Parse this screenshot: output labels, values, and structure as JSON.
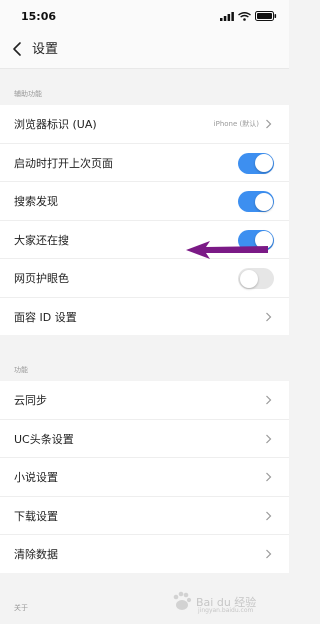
{
  "status_bar": {
    "time": "15:06"
  },
  "header": {
    "title": "设置"
  },
  "sections": [
    {
      "label": "辅助功能",
      "rows": [
        {
          "label": "浏览器标识 (UA)",
          "value": "iPhone (默认)",
          "control": "chevron"
        },
        {
          "label": "启动时打开上次页面",
          "control": "toggle",
          "on": true
        },
        {
          "label": "搜索发现",
          "control": "toggle",
          "on": true
        },
        {
          "label": "大家还在搜",
          "control": "toggle",
          "on": true
        },
        {
          "label": "网页护眼色",
          "control": "toggle",
          "on": false
        },
        {
          "label": "面容 ID 设置",
          "control": "chevron"
        }
      ]
    },
    {
      "label": "功能",
      "rows": [
        {
          "label": "云同步",
          "control": "chevron"
        },
        {
          "label": "UC头条设置",
          "control": "chevron"
        },
        {
          "label": "小说设置",
          "control": "chevron"
        },
        {
          "label": "下载设置",
          "control": "chevron"
        },
        {
          "label": "清除数据",
          "control": "chevron"
        }
      ]
    },
    {
      "label": "关于",
      "rows": []
    }
  ],
  "annotation": {
    "arrow_color": "#7b1a86"
  },
  "colors": {
    "toggle_on": "#3d8ff0",
    "toggle_off": "#e6e6e6",
    "background": "#f3f3f3"
  },
  "watermark": {
    "text": "Bai du 经验",
    "sub": "jingyan.baidu.com"
  }
}
